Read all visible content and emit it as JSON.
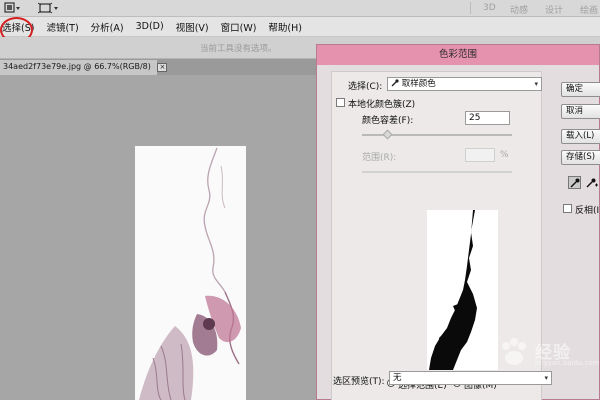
{
  "appbar": {
    "workspaces": [
      "3D",
      "动感",
      "设计",
      "绘画"
    ]
  },
  "menu": {
    "items": [
      "选择(S)",
      "滤镜(T)",
      "分析(A)",
      "3D(D)",
      "视图(V)",
      "窗口(W)",
      "帮助(H)"
    ]
  },
  "options_bar": {
    "hint": "当前工具没有选项。"
  },
  "document": {
    "tab_label": "34aed2f73e79e.jpg @ 66.7%(RGB/8)",
    "close": "×"
  },
  "dialog": {
    "title": "色彩范围",
    "select_label": "选择(C):",
    "select_value": "取样颜色",
    "localized_label": "本地化颜色簇(Z)",
    "fuzziness_label": "颜色容差(F):",
    "fuzziness_value": "25",
    "range_label": "范围(R):",
    "range_unit": "%",
    "radio_selection": "选择范围(E)",
    "radio_image": "图像(M)",
    "preview_label": "选区预览(T):",
    "preview_value": "无",
    "buttons": {
      "ok": "确定",
      "cancel": "取消",
      "load": "载入(L)",
      "save": "存储(S)"
    },
    "invert_label": "反相(I)"
  },
  "watermark": {
    "text": "经验",
    "sub": "jingyan.baidu.com"
  }
}
